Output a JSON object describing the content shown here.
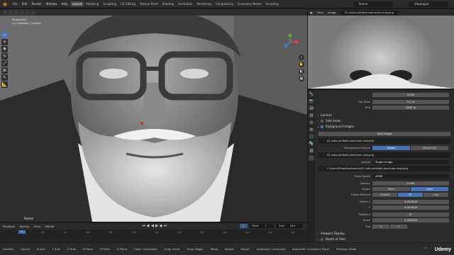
{
  "topbar": {
    "menus": [
      "File",
      "Edit",
      "Render",
      "Window",
      "Help"
    ],
    "tabs": [
      "Layout",
      "Modeling",
      "Sculpting",
      "UV Editing",
      "Texture Paint",
      "Shading",
      "Animation",
      "Rendering",
      "Compositing",
      "Geometry Nodes",
      "Scripting"
    ],
    "active_tab": "Layout",
    "scene": "Scene",
    "view_layer": "ViewLayer"
  },
  "viewport": {
    "info_line1": "Perspective",
    "info_line2": "(1) Collection | Camera",
    "footer_label": "Rotate",
    "header_prefix": "Object Mode"
  },
  "timeline": {
    "menus": [
      "Playback",
      "Keying",
      "View",
      "Marker"
    ],
    "ruler": [
      "0",
      "20",
      "40",
      "60",
      "80",
      "100",
      "120",
      "140",
      "160",
      "180",
      "200",
      "220",
      "240"
    ],
    "current_frame": "1",
    "start_label": "Start",
    "start": "1",
    "end_label": "End",
    "end": "250",
    "playhead": "1"
  },
  "statusbar": {
    "hints": [
      "Confirm",
      "Cancel",
      "X Axis",
      "Y Axis",
      "Z Axis",
      "X Plane",
      "Y Plane",
      "Z Plane",
      "Clear Constraints",
      "Snap Invert",
      "Snap Toggle",
      "Move",
      "Rotate",
      "Resize",
      "Automatic Constraint",
      "Automatic Constraint Plane",
      "Precision Mode"
    ],
    "version": "3.4"
  },
  "image_editor": {
    "menus": [
      "View",
      "Image"
    ],
    "filename": "02-india-amitabh-bachchan-indy.png"
  },
  "properties": {
    "lens_value": "0.000",
    "clip_start_label": "Clip Start",
    "clip_start": "0.1 m",
    "clip_end_label": "End",
    "clip_end": "1000 m",
    "camera_section": "Camera",
    "safe_areas": "Safe Areas",
    "background_images": "Background Images",
    "add_image": "Add Image",
    "image_item": "02-india-amitabh-bachchan-indy.png",
    "bg_source_label": "Background Source",
    "bg_source_options": [
      "Image",
      "Movie Clip"
    ],
    "image_datablock": "02-india-amitabh-bachchan-indy.png",
    "source_label": "Source",
    "source_value": "Single Image",
    "path": "C:\\Users\\Photos\\reference\\02-india-amitabh-bachchan-indy.png",
    "color_space_label": "Color Space",
    "color_space": "sRGB",
    "opacity_label": "Opacity",
    "opacity": "1.000",
    "depth_label": "Depth",
    "depth_options": [
      "Back",
      "Front"
    ],
    "frame_method_label": "Frame Method",
    "frame_options": [
      "Stretch",
      "Fit",
      "Crop"
    ],
    "offset_label": "Offset X",
    "offset_x": "0.000000",
    "y_label": "Y",
    "offset_y": "0.000000",
    "rotation_label": "Rotation",
    "rotation": "0°",
    "scale_label": "Scale",
    "scale": "1.000000",
    "flip_label": "Flip",
    "flip_x": "X",
    "flip_y": "Y",
    "viewport_display": "Viewport Display",
    "depth_of_field": "Depth of Field"
  },
  "watermark": "Udemy",
  "colors": {
    "accent": "#4772b3",
    "panel": "#2b2b2b",
    "viewport": "#5a5a5a"
  }
}
